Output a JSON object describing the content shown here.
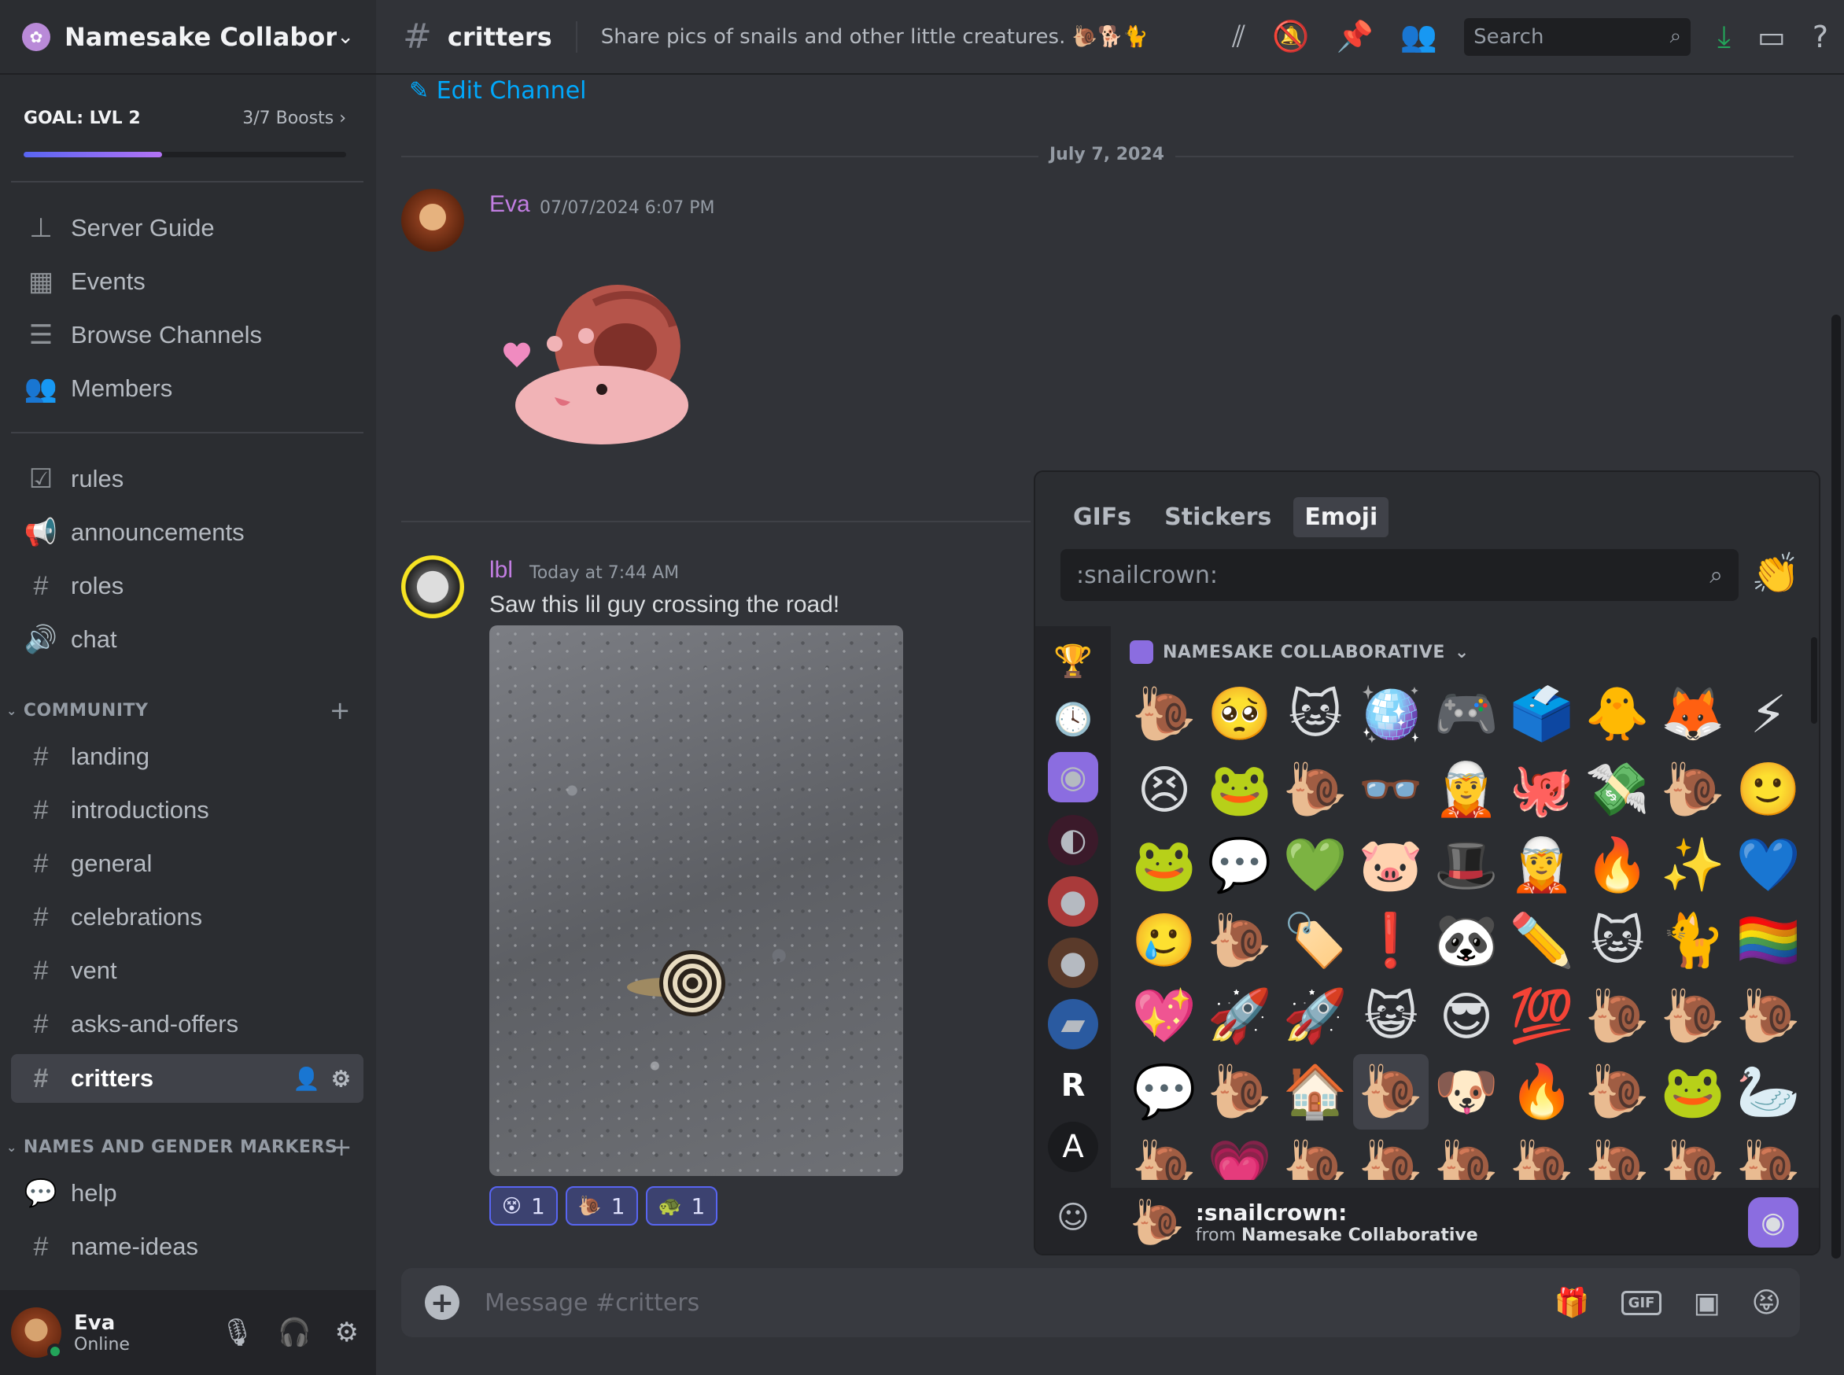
{
  "server": {
    "name": "Namesake Collabora...",
    "icon": "flower-icon"
  },
  "goal": {
    "label": "GOAL: LVL 2",
    "boosts": "3/7 Boosts",
    "progress": 0.43
  },
  "nav": [
    {
      "label": "Server Guide",
      "icon": "signpost-icon"
    },
    {
      "label": "Events",
      "icon": "calendar-icon"
    },
    {
      "label": "Browse Channels",
      "icon": "browse-icon"
    },
    {
      "label": "Members",
      "icon": "members-icon"
    }
  ],
  "channels_top": [
    {
      "label": "rules",
      "icon": "checkbox-icon"
    },
    {
      "label": "announcements",
      "icon": "megaphone-icon"
    },
    {
      "label": "roles",
      "icon": "hash-icon"
    },
    {
      "label": "chat",
      "icon": "speaker-icon"
    }
  ],
  "category_community": "COMMUNITY",
  "channels_community": [
    {
      "label": "landing"
    },
    {
      "label": "introductions"
    },
    {
      "label": "general"
    },
    {
      "label": "celebrations"
    },
    {
      "label": "vent"
    },
    {
      "label": "asks-and-offers"
    },
    {
      "label": "critters"
    }
  ],
  "category_names": "NAMES AND GENDER MARKERS",
  "channels_names": [
    {
      "label": "help",
      "icon": "forum-icon"
    },
    {
      "label": "name-ideas",
      "icon": "hash-icon"
    }
  ],
  "user": {
    "name": "Eva",
    "status": "Online"
  },
  "topbar": {
    "channel": "critters",
    "topic": "Share pics of snails and other little creatures. 🐌🐕🐈",
    "search_placeholder": "Search"
  },
  "edit_channel": "Edit Channel",
  "date_divider": "July 7, 2024",
  "messages": [
    {
      "author": "Eva",
      "time": "07/07/2024 6:07 PM",
      "text": ""
    },
    {
      "author": "lbl",
      "time": "Today at 7:44 AM",
      "text": "Saw this lil guy crossing the road!"
    }
  ],
  "reactions": [
    {
      "emoji": "😵",
      "count": "1"
    },
    {
      "emoji": "🐌",
      "count": "1"
    },
    {
      "emoji": "🐢",
      "count": "1"
    }
  ],
  "composer": {
    "placeholder": "Message #critters"
  },
  "picker": {
    "tabs": [
      "GIFs",
      "Stickers",
      "Emoji"
    ],
    "active_tab": "Emoji",
    "search_value": ":snailcrown:",
    "section": "NAMESAKE COLLABORATIVE",
    "emojis": [
      "🐌",
      "🥺",
      "🐱",
      "🪩",
      "🎮",
      "🗳️",
      "🐥",
      "🦊",
      "⚡",
      "😣",
      "🐸",
      "🐌",
      "👓",
      "🧝",
      "🐙",
      "💸",
      "🐌",
      "🙂",
      "🐸",
      "💬",
      "💚",
      "🐷",
      "🎩",
      "🧝",
      "🔥",
      "✨",
      "💙",
      "🥲",
      "🐌",
      "🏷️",
      "❗",
      "🐼",
      "✏️",
      "🐱",
      "🐈",
      "🏳️‍🌈",
      "💖",
      "🚀",
      "🚀",
      "😺",
      "😎",
      "💯",
      "🐌",
      "🐌",
      "🐌",
      "💬",
      "🐌",
      "🏠",
      "🐌",
      "🐶",
      "🔥",
      "🐌",
      "🐸",
      "🦢",
      "🐌",
      "💗",
      "🐌",
      "🐌",
      "🐌",
      "🐌",
      "🐌",
      "🐌",
      "🐌"
    ],
    "selected_index": 48,
    "footer": {
      "name": ":snailcrown:",
      "from_prefix": "from ",
      "from_server": "Namesake Collaborative",
      "emoji": "🐌"
    }
  },
  "colors": {
    "accent": "#5865f2",
    "author": "#c27ee2",
    "link": "#00a8fc",
    "online": "#23a55a"
  }
}
